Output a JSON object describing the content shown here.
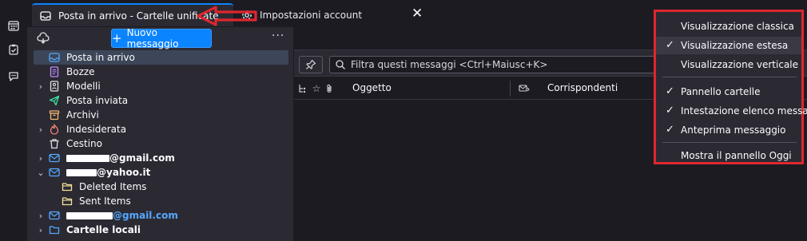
{
  "tabs": {
    "active_label": "Posta in arrivo - Cartelle unificate",
    "inactive_label": "Impostazioni account",
    "close_glyph": "✕"
  },
  "folder_pane": {
    "new_message_label": "Nuovo messaggio",
    "more_glyph": "···",
    "items": [
      {
        "label": "Posta in arrivo",
        "icon": "inbox-icon"
      },
      {
        "label": "Bozze",
        "icon": "drafts-icon"
      },
      {
        "label": "Modelli",
        "icon": "templates-icon"
      },
      {
        "label": "Posta inviata",
        "icon": "sent-icon"
      },
      {
        "label": "Archivi",
        "icon": "archive-icon"
      },
      {
        "label": "Indesiderata",
        "icon": "junk-icon"
      },
      {
        "label": "Cestino",
        "icon": "trash-icon"
      },
      {
        "label": "@gmail.com",
        "icon": "account-icon"
      },
      {
        "label": "@yahoo.it",
        "icon": "account-icon"
      },
      {
        "label": "Deleted Items",
        "icon": "folder-icon"
      },
      {
        "label": "Sent Items",
        "icon": "folder-icon"
      },
      {
        "label": "@gmail.com",
        "icon": "account-icon"
      },
      {
        "label": "Cartelle locali",
        "icon": "local-folders-icon"
      }
    ]
  },
  "message_list": {
    "filter_placeholder": "Filtra questi messaggi <Ctrl+Maiusc+K>",
    "col_subject": "Oggetto",
    "col_correspondents": "Corrispondenti"
  },
  "view_menu": {
    "items": [
      {
        "label": "Visualizzazione classica",
        "checked": false
      },
      {
        "label": "Visualizzazione estesa",
        "checked": true
      },
      {
        "label": "Visualizzazione verticale",
        "checked": false
      },
      {
        "label": "Pannello cartelle",
        "checked": true
      },
      {
        "label": "Intestazione elenco messaggi",
        "checked": true
      },
      {
        "label": "Anteprima messaggio",
        "checked": true
      },
      {
        "label": "Mostra il pannello Oggi",
        "checked": false
      }
    ],
    "check_glyph": "✓"
  },
  "colors": {
    "accent": "#0a84ff",
    "annotation_red": "#e0262d"
  }
}
